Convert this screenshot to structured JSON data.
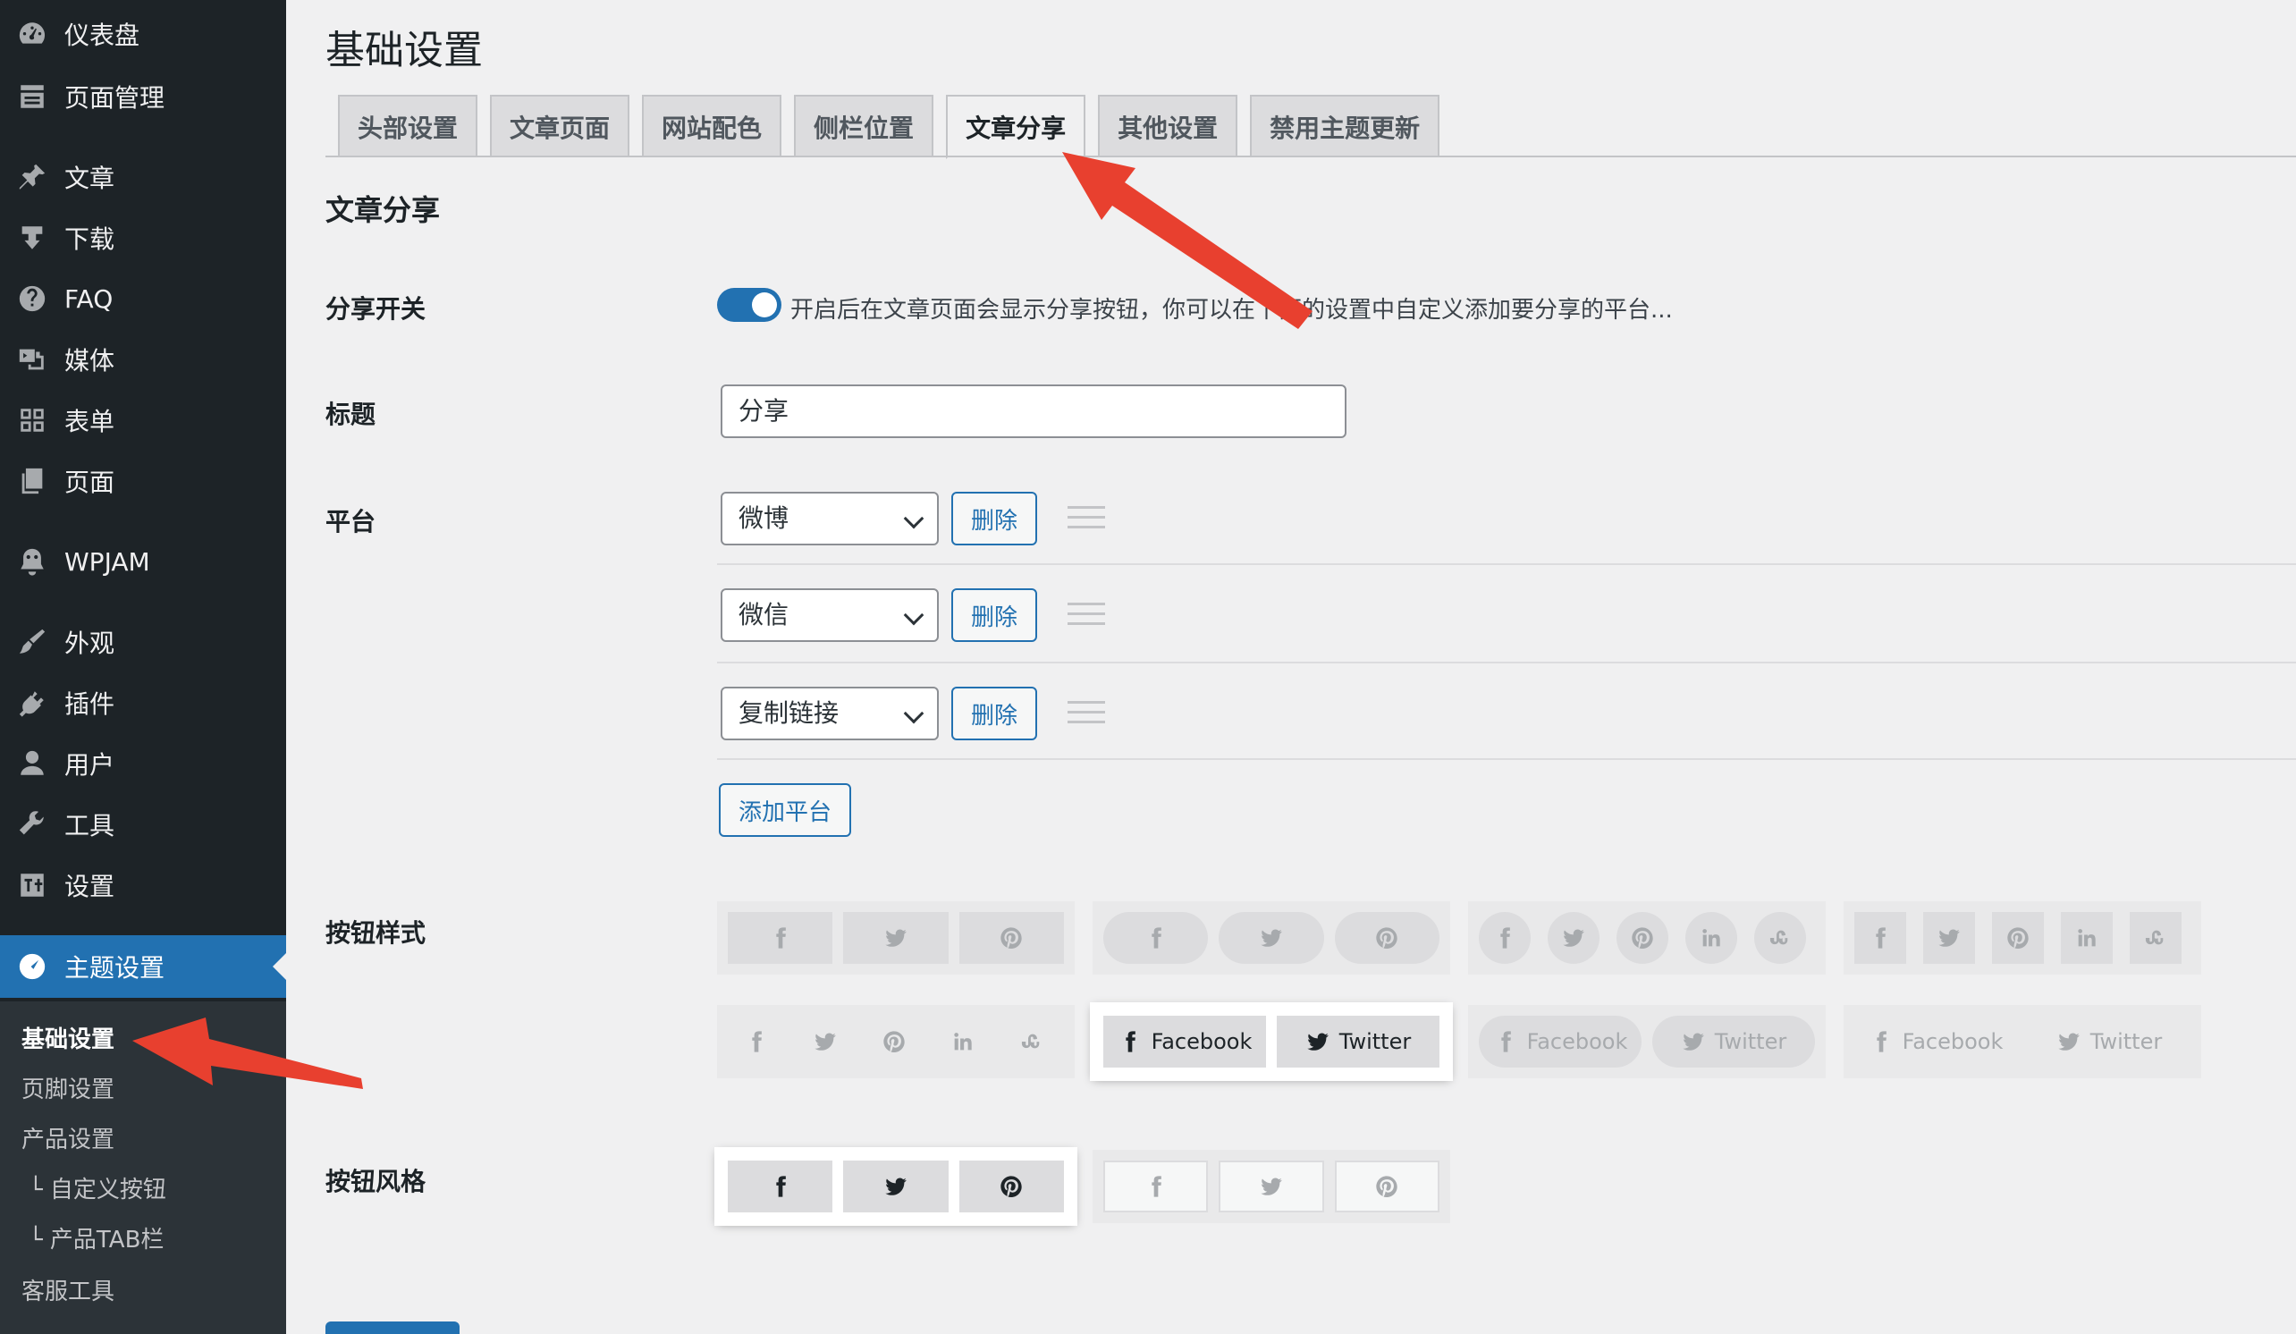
{
  "sidebar": {
    "items": [
      {
        "label": "仪表盘",
        "icon": "dashboard-icon"
      },
      {
        "label": "页面管理",
        "icon": "page-manage-icon"
      },
      {
        "label": "文章",
        "icon": "pin-icon"
      },
      {
        "label": "下载",
        "icon": "download-icon"
      },
      {
        "label": "FAQ",
        "icon": "help-icon"
      },
      {
        "label": "媒体",
        "icon": "media-icon"
      },
      {
        "label": "表单",
        "icon": "form-icon"
      },
      {
        "label": "页面",
        "icon": "pages-icon"
      },
      {
        "label": "WPJAM",
        "icon": "wpjam-icon"
      },
      {
        "label": "外观",
        "icon": "appearance-icon"
      },
      {
        "label": "插件",
        "icon": "plugin-icon"
      },
      {
        "label": "用户",
        "icon": "user-icon"
      },
      {
        "label": "工具",
        "icon": "tools-icon"
      },
      {
        "label": "设置",
        "icon": "settings-icon"
      },
      {
        "label": "主题设置",
        "icon": "theme-settings-icon"
      }
    ],
    "submenu": [
      "基础设置",
      "页脚设置",
      "产品设置",
      "└ 自定义按钮",
      "└ 产品TAB栏",
      "客服工具"
    ]
  },
  "page": {
    "title": "基础设置",
    "tabs": [
      "头部设置",
      "文章页面",
      "网站配色",
      "侧栏位置",
      "文章分享",
      "其他设置",
      "禁用主题更新"
    ],
    "section_title": "文章分享"
  },
  "form": {
    "share_switch_label": "分享开关",
    "share_switch_on": true,
    "share_switch_desc": "开启后在文章页面会显示分享按钮，你可以在下面的设置中自定义添加要分享的平台...",
    "title_label": "标题",
    "title_value": "分享",
    "platform_label": "平台",
    "platforms": [
      "微博",
      "微信",
      "复制链接"
    ],
    "delete_label": "删除",
    "add_platform_label": "添加平台",
    "button_style_label": "按钮样式",
    "button_theme_label": "按钮风格",
    "facebook": "Facebook",
    "twitter": "Twitter"
  },
  "colors": {
    "sidebar_bg": "#1d2327",
    "accent": "#2271b1",
    "arrow": "#e8402f"
  }
}
